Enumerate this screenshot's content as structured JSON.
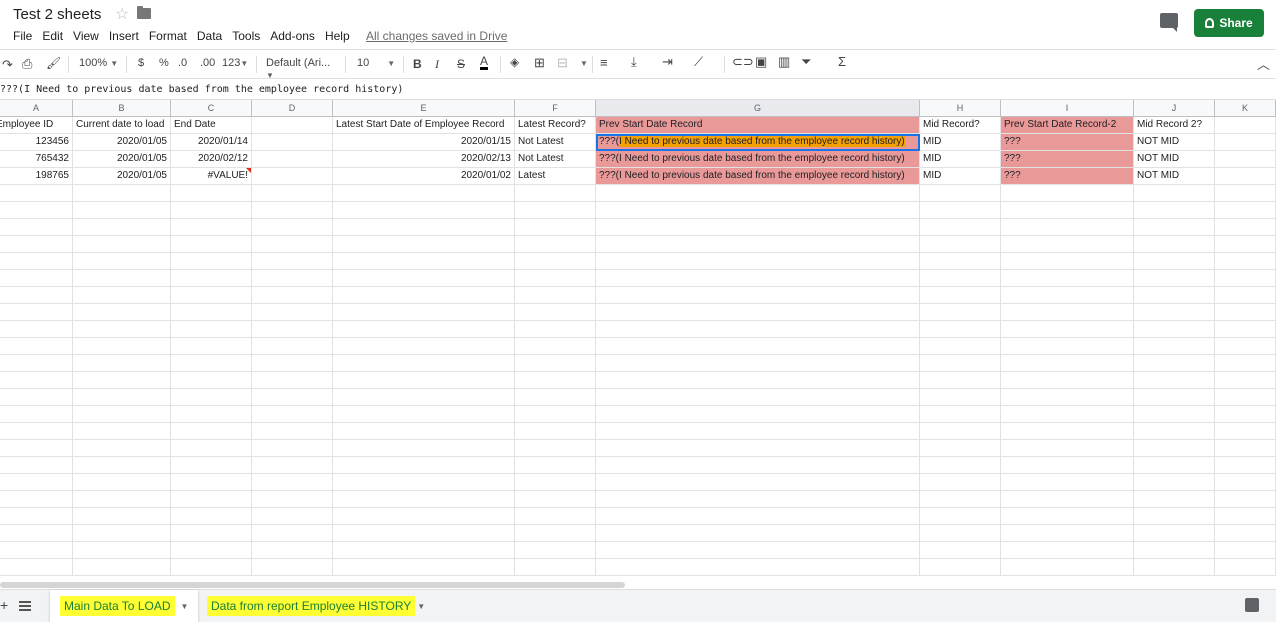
{
  "title": "Test 2 sheets",
  "menu": [
    "File",
    "Edit",
    "View",
    "Insert",
    "Format",
    "Data",
    "Tools",
    "Add-ons",
    "Help"
  ],
  "saved_status": "All changes saved in Drive",
  "share_label": "Share",
  "toolbar": {
    "zoom": "100%",
    "currency": "$",
    "percent": "%",
    "dec_decrease": ".0",
    "dec_increase": ".00",
    "more_formats": "123",
    "font": "Default (Ari...",
    "font_size": "10",
    "bold": "B",
    "italic": "I",
    "strike": "S",
    "text_color": "A"
  },
  "formula": "???(I Need to previous date based from the employee record history)",
  "columns": [
    "A",
    "B",
    "C",
    "D",
    "E",
    "F",
    "G",
    "H",
    "I",
    "J",
    "K"
  ],
  "rows": [
    [
      "Employee ID",
      "Current date to load",
      "End Date",
      "",
      "Latest Start Date of Employee Record",
      "Latest Record?",
      "Prev Start Date Record",
      "Mid Record?",
      "Prev Start Date Record-2",
      "Mid Record 2?",
      ""
    ],
    [
      "123456",
      "2020/01/05",
      "2020/01/14",
      "",
      "2020/01/15",
      "Not Latest",
      "???(I Need to previous date based from the employee record history)",
      "MID",
      "???",
      "NOT MID",
      ""
    ],
    [
      "765432",
      "2020/01/05",
      "2020/02/12",
      "",
      "2020/02/13",
      "Not Latest",
      "???(I Need to previous date based from the employee record history)",
      "MID",
      "???",
      "NOT MID",
      ""
    ],
    [
      "198765",
      "2020/01/05",
      "#VALUE!",
      "",
      "2020/01/02",
      "Latest",
      "???(I Need to previous date based from the employee record history)",
      "MID",
      "???",
      "NOT MID",
      ""
    ]
  ],
  "sheets": [
    "Main Data To LOAD",
    "Data from report Employee HISTORY"
  ],
  "colors": {
    "pink_fill": "#ea9999",
    "share_green": "#188038",
    "highlight_yellow": "#ffff33",
    "orange": "#f4a000"
  }
}
